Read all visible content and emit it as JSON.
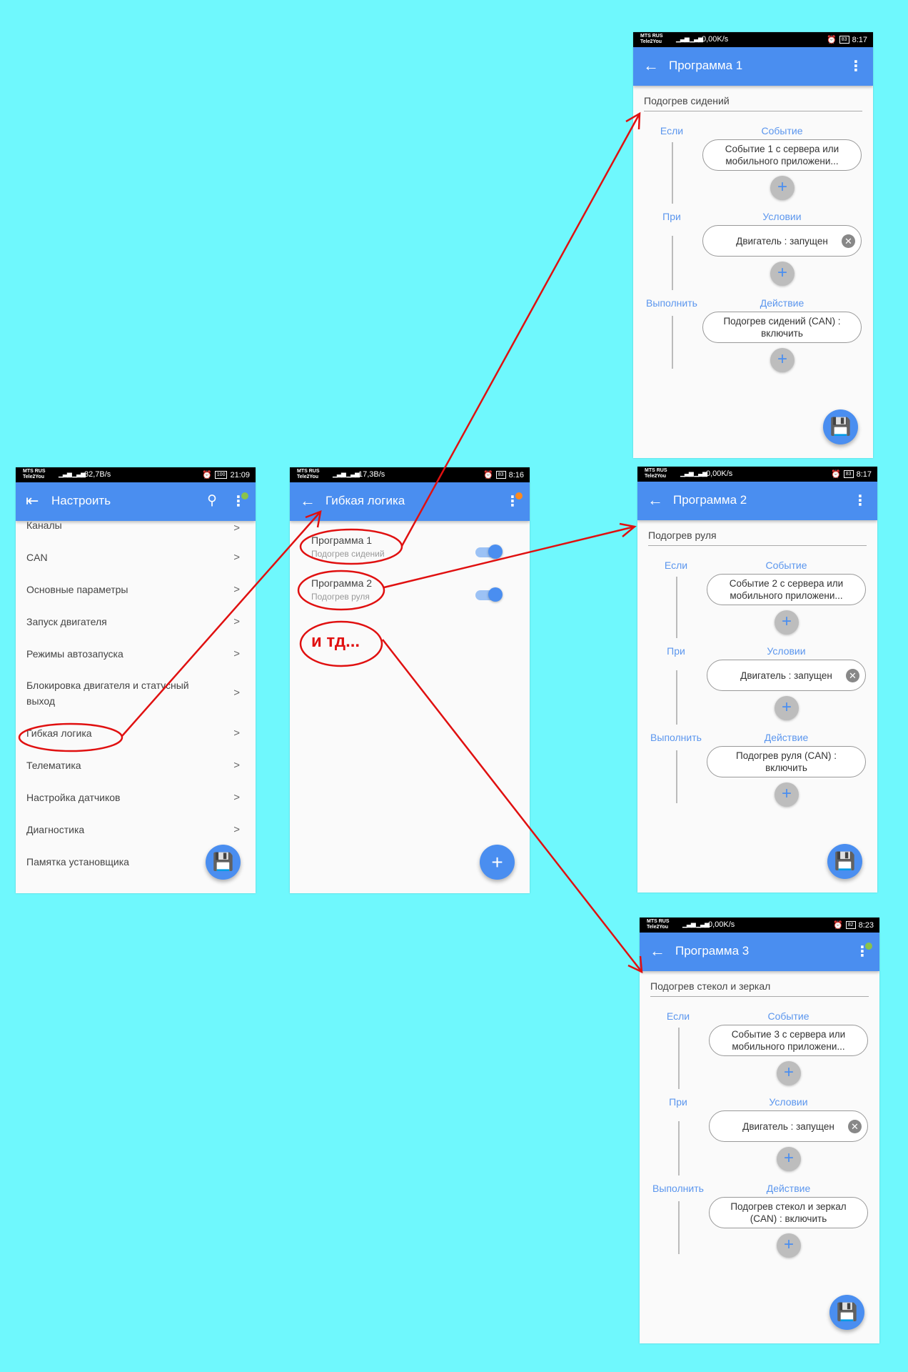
{
  "colors": {
    "background": "#6ff8fd",
    "appbar": "#4a8ef0",
    "annotation": "#e01010",
    "label": "#5b96ee"
  },
  "settings_screen": {
    "status": {
      "carrier1": "MTS RUS",
      "carrier2": "Tele2You",
      "speed": "32,7B/s",
      "battery": "100",
      "time": "21:09"
    },
    "title": "Настроить",
    "items": [
      "Каналы",
      "CAN",
      "Основные параметры",
      "Запуск двигателя",
      "Режимы автозапуска",
      "Блокировка двигателя и статусный выход",
      "Гибкая логика",
      "Телематика",
      "Настройка датчиков",
      "Диагностика",
      "Памятка установщика"
    ],
    "fab_icon": "save-icon"
  },
  "logic_screen": {
    "status": {
      "carrier1": "MTS RUS",
      "carrier2": "Tele2You",
      "speed": "17,3B/s",
      "battery": "83",
      "time": "8:16"
    },
    "title": "Гибкая логика",
    "programs": [
      {
        "title": "Программа 1",
        "subtitle": "Подогрев сидений",
        "enabled": true
      },
      {
        "title": "Программа 2",
        "subtitle": "Подогрев руля",
        "enabled": true
      }
    ],
    "fab_icon": "plus-icon"
  },
  "program_screens": [
    {
      "status": {
        "carrier1": "MTS RUS",
        "carrier2": "Tele2You",
        "speed": "0,00K/s",
        "battery": "83",
        "time": "8:17"
      },
      "title": "Программа 1",
      "name": "Подогрев сидений",
      "if_label": "Если",
      "event_header": "Событие",
      "event": "Событие  1 с сервера или мобильного приложени...",
      "when_label": "При",
      "condition_header": "Условии",
      "condition": "Двигатель : запущен",
      "do_label": "Выполнить",
      "action_header": "Действие",
      "action": "Подогрев сидений (CAN) : включить",
      "menu_dot": ""
    },
    {
      "status": {
        "carrier1": "MTS RUS",
        "carrier2": "Tele2You",
        "speed": "0,00K/s",
        "battery": "83",
        "time": "8:17"
      },
      "title": "Программа 2",
      "name": "Подогрев руля",
      "if_label": "Если",
      "event_header": "Событие",
      "event": "Событие  2 с сервера или мобильного приложени...",
      "when_label": "При",
      "condition_header": "Условии",
      "condition": "Двигатель : запущен",
      "do_label": "Выполнить",
      "action_header": "Действие",
      "action": "Подогрев руля (CAN) : включить",
      "menu_dot": ""
    },
    {
      "status": {
        "carrier1": "MTS RUS",
        "carrier2": "Tele2You",
        "speed": "0,00K/s",
        "battery": "82",
        "time": "8:23"
      },
      "title": "Программа 3",
      "name": "Подогрев стекол и зеркал",
      "if_label": "Если",
      "event_header": "Событие",
      "event": "Событие  3 с сервера или мобильного приложени...",
      "when_label": "При",
      "condition_header": "Условии",
      "condition": "Двигатель : запущен",
      "do_label": "Выполнить",
      "action_header": "Действие",
      "action": "Подогрев стекол и зеркал (CAN) : включить",
      "menu_dot": "#8bc34a"
    }
  ],
  "annotation": {
    "etc_text": "и тд..."
  }
}
